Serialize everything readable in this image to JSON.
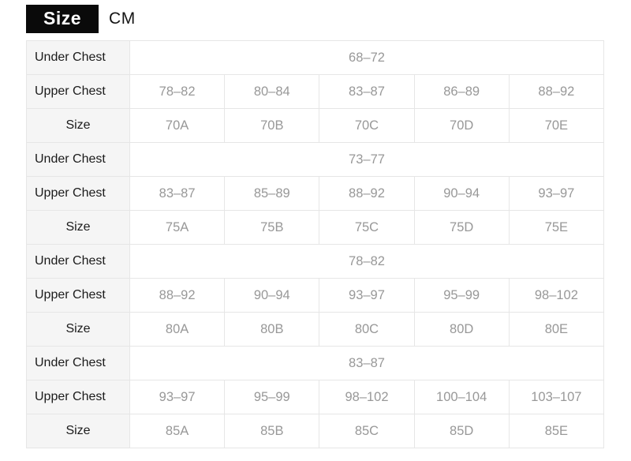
{
  "header": {
    "badge_label": "Size",
    "unit_label": "CM"
  },
  "table": {
    "row_labels": {
      "under_chest": "Under Chest",
      "upper_chest": "Upper Chest",
      "size": "Size"
    },
    "blocks": [
      {
        "under_chest": "68–72",
        "upper_chest": [
          "78–82",
          "80–84",
          "83–87",
          "86–89",
          "88–92"
        ],
        "sizes": [
          "70A",
          "70B",
          "70C",
          "70D",
          "70E"
        ]
      },
      {
        "under_chest": "73–77",
        "upper_chest": [
          "83–87",
          "85–89",
          "88–92",
          "90–94",
          "93–97"
        ],
        "sizes": [
          "75A",
          "75B",
          "75C",
          "75D",
          "75E"
        ]
      },
      {
        "under_chest": "78–82",
        "upper_chest": [
          "88–92",
          "90–94",
          "93–97",
          "95–99",
          "98–102"
        ],
        "sizes": [
          "80A",
          "80B",
          "80C",
          "80D",
          "80E"
        ]
      },
      {
        "under_chest": "83–87",
        "upper_chest": [
          "93–97",
          "95–99",
          "98–102",
          "100–104",
          "103–107"
        ],
        "sizes": [
          "85A",
          "85B",
          "85C",
          "85D",
          "85E"
        ]
      }
    ]
  },
  "colors": {
    "badge_background": "#0a0a0a",
    "badge_text": "#ffffff",
    "unit_text": "#141414",
    "label_background": "#f5f5f5",
    "label_text": "#1b1b1b",
    "value_text": "#989898",
    "border": "#e6e6e6",
    "page_background": "#ffffff"
  }
}
